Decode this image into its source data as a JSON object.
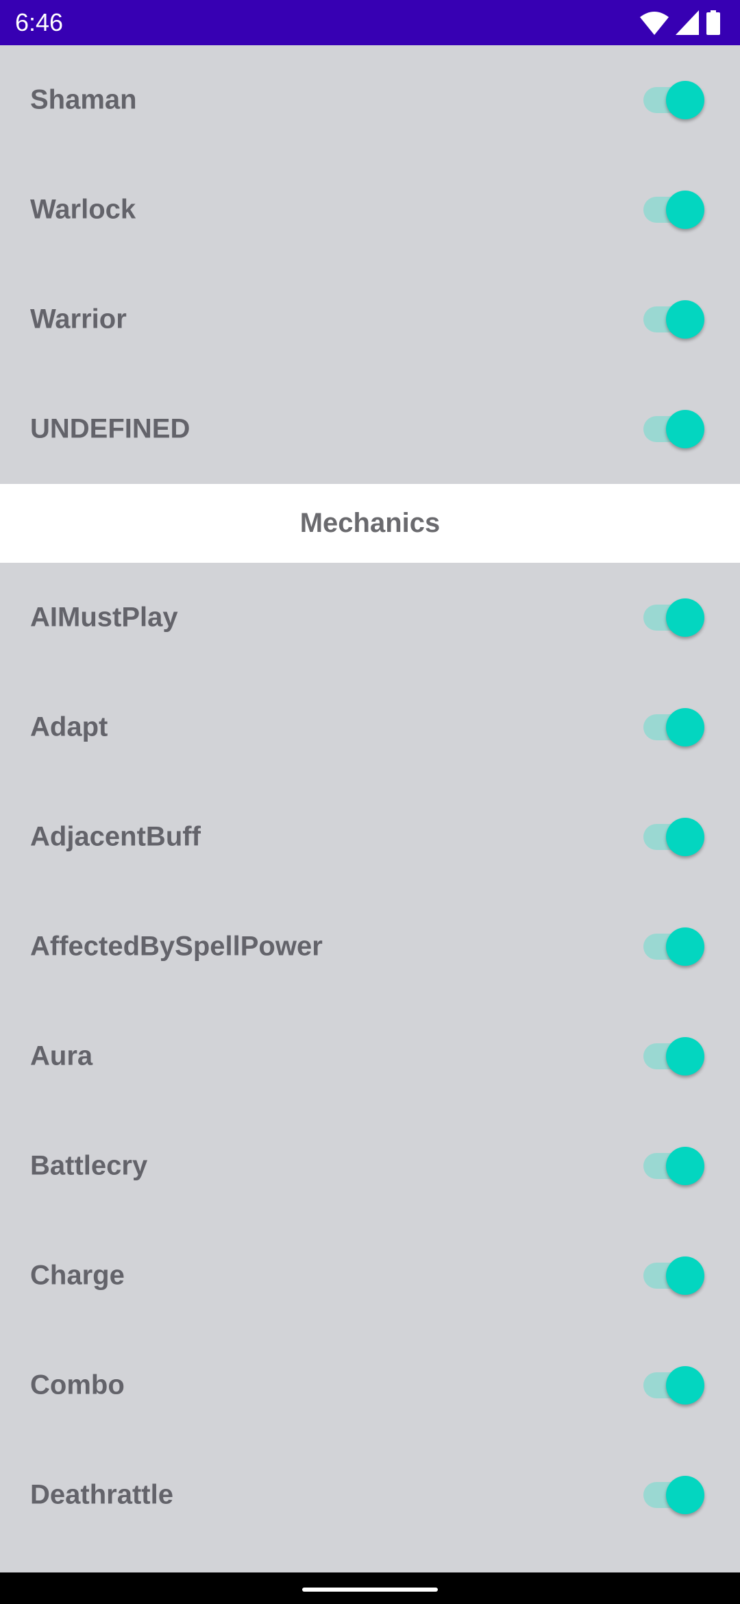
{
  "status_bar": {
    "time": "6:46",
    "icons": [
      "wifi-icon",
      "signal-icon",
      "battery-icon"
    ]
  },
  "colors": {
    "status_bar": "#3700b3",
    "toggle_thumb": "#03d6c0",
    "toggle_track": "#9ad8d2",
    "background": "#d2d3d7"
  },
  "class_items": [
    {
      "label": "Shaman",
      "on": true
    },
    {
      "label": "Warlock",
      "on": true
    },
    {
      "label": "Warrior",
      "on": true
    },
    {
      "label": "UNDEFINED",
      "on": true
    }
  ],
  "mechanics_header": "Mechanics",
  "mechanics_items": [
    {
      "label": "AIMustPlay",
      "on": true
    },
    {
      "label": "Adapt",
      "on": true
    },
    {
      "label": "AdjacentBuff",
      "on": true
    },
    {
      "label": "AffectedBySpellPower",
      "on": true
    },
    {
      "label": "Aura",
      "on": true
    },
    {
      "label": "Battlecry",
      "on": true
    },
    {
      "label": "Charge",
      "on": true
    },
    {
      "label": "Combo",
      "on": true
    },
    {
      "label": "Deathrattle",
      "on": true
    }
  ]
}
